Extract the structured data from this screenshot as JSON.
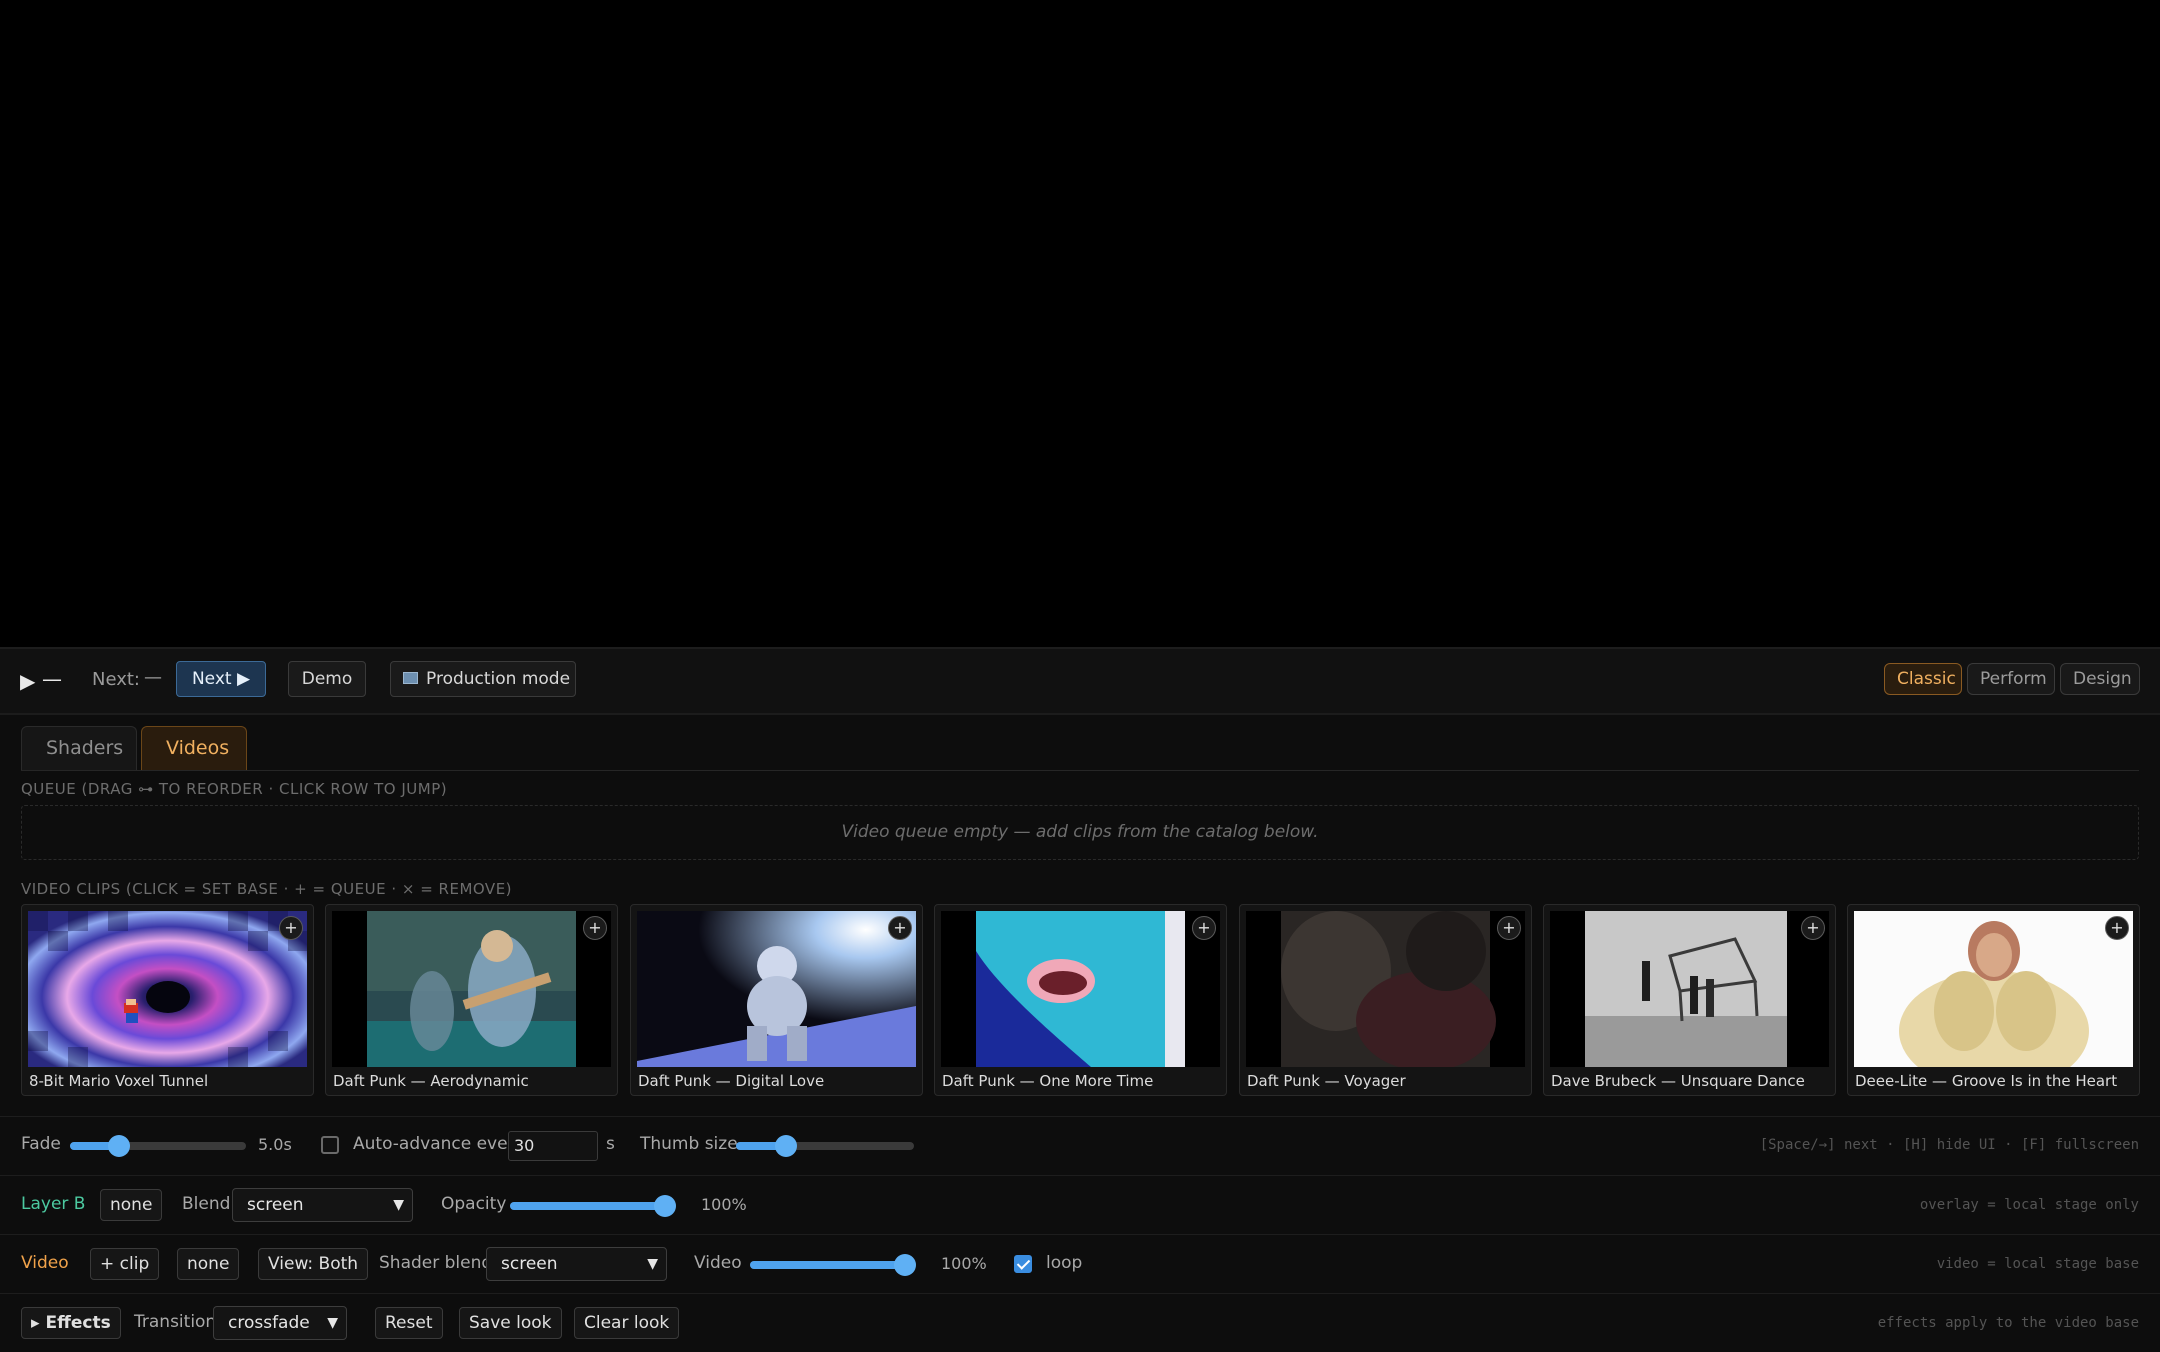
{
  "transport": {
    "play_glyph": "▶",
    "now_playing": "—",
    "next_label": "Next:",
    "next_value": "—",
    "next_button": "Next ▶",
    "demo_button": "Demo",
    "production_button": "Production mode"
  },
  "modes": {
    "classic": "Classic",
    "perform": "Perform",
    "design": "Design",
    "active": "Classic"
  },
  "tabs": [
    {
      "label": "Shaders",
      "active": false
    },
    {
      "label": "Videos",
      "active": true
    }
  ],
  "queue": {
    "label": "QUEUE (DRAG ⊶ TO REORDER · CLICK ROW TO JUMP)",
    "empty_text": "Video queue empty — add clips from the catalog below."
  },
  "clips": {
    "label": "VIDEO CLIPS (CLICK = SET BASE · + = QUEUE · × = REMOVE)",
    "add_glyph": "+",
    "items": [
      {
        "title": "8-Bit Mario Voxel Tunnel",
        "thumb": "tunnel"
      },
      {
        "title": "Daft Punk — Aerodynamic",
        "thumb": "band"
      },
      {
        "title": "Daft Punk — Digital Love",
        "thumb": "astronaut"
      },
      {
        "title": "Daft Punk — One More Time",
        "thumb": "face"
      },
      {
        "title": "Daft Punk — Voyager",
        "thumb": "dark"
      },
      {
        "title": "Dave Brubeck — Unsquare Dance",
        "thumb": "bw-dance"
      },
      {
        "title": "Deee-Lite — Groove Is in the Heart",
        "thumb": "singer"
      }
    ]
  },
  "controls": {
    "fade_label": "Fade",
    "fade_value": "5.0s",
    "fade_fraction": 0.28,
    "auto_advance_label": "Auto-advance every",
    "auto_advance_checked": false,
    "auto_advance_seconds": "30",
    "auto_advance_unit": "s",
    "thumb_size_label": "Thumb size",
    "thumb_size_fraction": 0.28,
    "shortcuts_hint": "[Space/→] next · [H] hide UI · [F] fullscreen"
  },
  "layer_b": {
    "label": "Layer B",
    "none_button": "none",
    "blend_label": "Blend",
    "blend_value": "screen",
    "opacity_label": "Opacity",
    "opacity_value": "100%",
    "opacity_fraction": 1.0,
    "hint": "overlay = local stage only"
  },
  "video": {
    "label": "Video",
    "add_clip_button": "+ clip",
    "none_button": "none",
    "view_button": "View: Both",
    "shader_blend_label": "Shader blend",
    "shader_blend_value": "screen",
    "video_label": "Video",
    "video_value": "100%",
    "video_fraction": 1.0,
    "loop_label": "loop",
    "loop_checked": true,
    "hint": "video = local stage base"
  },
  "effects": {
    "toggle_button": "▸ Effects",
    "transition_label": "Transition",
    "transition_value": "crossfade",
    "reset_button": "Reset",
    "save_button": "Save look",
    "clear_button": "Clear look",
    "hint": "effects apply to the video base"
  },
  "colors": {
    "accent": "#f0b060",
    "slider": "#4fa3ee",
    "layer_b": "#4cc9a0",
    "video": "#f0a24a"
  }
}
